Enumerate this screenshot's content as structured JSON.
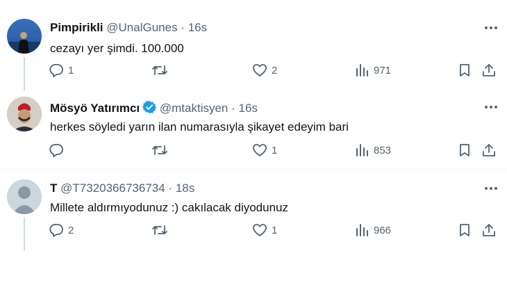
{
  "tweets": [
    {
      "name": "Pimpirikli",
      "handle": "@UnalGunes",
      "separator": "·",
      "time": "16s",
      "verified": false,
      "text": "cezayı yer şimdi. 100.000",
      "replies": "1",
      "retweets": "",
      "likes": "2",
      "views": "971"
    },
    {
      "name": "Mösyö Yatırımcı",
      "handle": "@mtaktisyen",
      "separator": "·",
      "time": "16s",
      "verified": true,
      "text": "herkes söyledi yarın ilan numarasıyla şikayet edeyim bari",
      "replies": "",
      "retweets": "",
      "likes": "1",
      "views": "853"
    },
    {
      "name": "T",
      "handle": "@T7320366736734",
      "separator": "·",
      "time": "18s",
      "verified": false,
      "text": "Millete aldırmıyodunuz :) cakılacak diyodunuz",
      "replies": "2",
      "retweets": "",
      "likes": "1",
      "views": "966"
    }
  ],
  "colors": {
    "text_primary": "#0f1419",
    "text_secondary": "#536471",
    "verified_blue": "#1d9bf0",
    "divider": "#eff3f4",
    "thread_line": "#cfd9de"
  },
  "icons": [
    "more-icon",
    "reply-icon",
    "retweet-icon",
    "like-icon",
    "views-icon",
    "bookmark-icon",
    "share-icon",
    "verified-icon"
  ]
}
